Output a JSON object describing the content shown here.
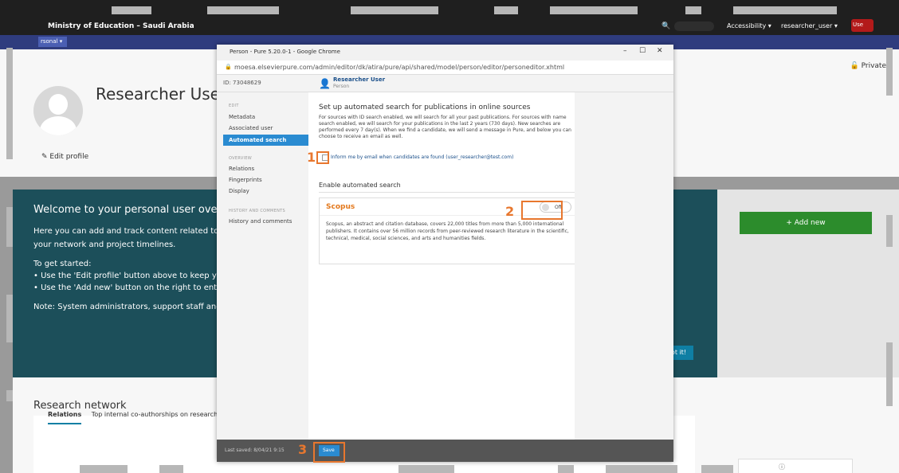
{
  "topbar": {
    "institution": "Ministry of Education – Saudi Arabia",
    "accessibility": "Accessibility ▾",
    "user": "researcher_user ▾",
    "user_badge": "Use",
    "personal": "rsonal ▾"
  },
  "profile": {
    "name": "Researcher User",
    "edit": "✎ Edit profile",
    "private": "🔓 Private"
  },
  "welcome": {
    "title": "Welcome to your personal user overview",
    "lead": "Here you can add and track content related to your network and project timelines.",
    "get_started": "To get started:",
    "bullet1": "• Use the 'Edit profile' button above to keep your",
    "bullet2": "• Use the 'Add new' button on the right to enter",
    "note": "Note: System administrators, support staff and t",
    "got_it": "ot it!"
  },
  "add_new": "+ Add new",
  "network": {
    "title": "Research network",
    "tab_relations": "Relations",
    "tab_top": "Top internal co-authorships on research o"
  },
  "popup": {
    "window_title": "Person - Pure 5.20.0-1 - Google Chrome",
    "url": "moesa.elsevierpure.com/admin/editor/dk/atira/pure/api/shared/model/person/editor/personeditor.xhtml",
    "id": "ID: 73048629",
    "person_name": "Researcher User",
    "person_type": "Person",
    "nav": {
      "edit_section": "EDIT",
      "metadata": "Metadata",
      "associated_user": "Associated user",
      "automated_search": "Automated search",
      "overview_section": "OVERVIEW",
      "relations": "Relations",
      "fingerprints": "Fingerprints",
      "display": "Display",
      "history_section": "HISTORY AND COMMENTS",
      "history": "History and comments"
    },
    "heading": "Set up automated search for publications in online sources",
    "description": "For sources with ID search enabled, we will search for all your past publications. For sources with name search enabled, we will search for your publications in the last 2 years (730 days). New searches are performed every 7 day(s). When we find a candidate, we will send a message in Pure, and below you can choose to receive an email as well.",
    "email_checkbox": "Inform me by email when candidates are found (user_researcher@test.com)",
    "enable_heading": "Enable automated search",
    "scopus_name": "Scopus",
    "toggle_label": "Off",
    "scopus_desc": "Scopus, an abstract and citation database, covers 22,000 titles from more than 5,000 international publishers. It contains over 56 million records from peer-reviewed research literature in the scientific, technical, medical, social sciences, and arts and humanities fields.",
    "last_saved": "Last saved: 8/04/21 9:15",
    "save": "Save"
  },
  "markers": {
    "m1": "1",
    "m2": "2",
    "m3": "3"
  },
  "colors": {
    "accent": "#2a8bd1",
    "highlight": "#e8772e",
    "scopus": "#e3781c",
    "welcome_bg": "#1c4f5a",
    "add_new": "#2c8c2c"
  }
}
